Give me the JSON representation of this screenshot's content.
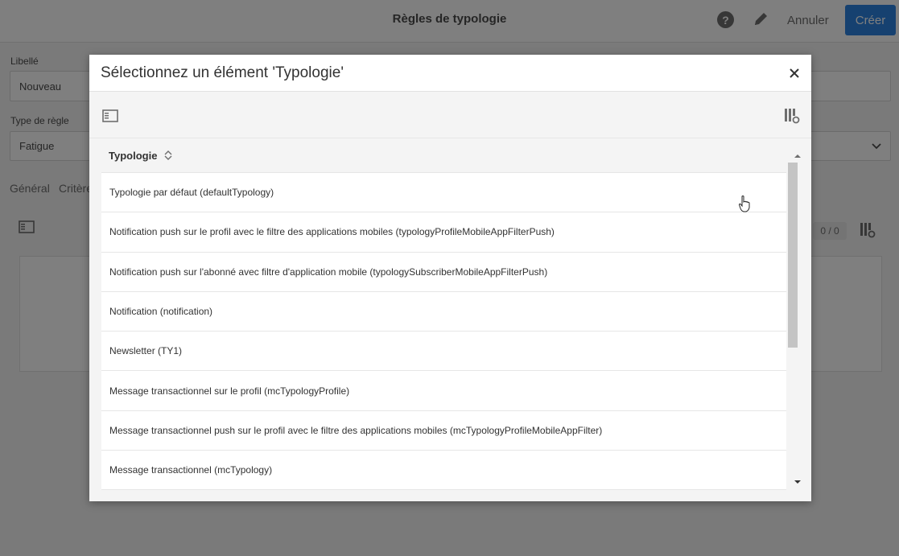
{
  "topbar": {
    "title": "Règles de typologie",
    "help_label": "?",
    "cancel_label": "Annuler",
    "create_label": "Créer"
  },
  "form": {
    "label_field": {
      "label": "Libellé",
      "value": "Nouveau"
    },
    "rule_type": {
      "label": "Type de règle",
      "value": "Fatigue"
    },
    "tabs": [
      {
        "label": "Général"
      },
      {
        "label": "Critère"
      }
    ],
    "counter": "0 / 0"
  },
  "modal": {
    "title": "Sélectionnez un élément 'Typologie'",
    "column_header": "Typologie",
    "rows": [
      {
        "label": "Typologie par défaut (defaultTypology)"
      },
      {
        "label": "Notification push sur le profil avec le filtre des applications mobiles (typologyProfileMobileAppFilterPush)"
      },
      {
        "label": "Notification push sur l'abonné avec filtre d'application mobile (typologySubscriberMobileAppFilterPush)"
      },
      {
        "label": "Notification (notification)"
      },
      {
        "label": "Newsletter (TY1)"
      },
      {
        "label": "Message transactionnel sur le profil (mcTypologyProfile)"
      },
      {
        "label": "Message transactionnel push sur le profil avec le filtre des applications mobiles (mcTypologyProfileMobileAppFilter)"
      },
      {
        "label": "Message transactionnel (mcTypology)"
      }
    ]
  },
  "icons": {
    "help": "help-circle-icon",
    "edit": "pencil-icon",
    "close": "close-icon",
    "panel": "panel-toggle-icon",
    "columns": "column-settings-icon",
    "sort": "sort-icon",
    "dropdown": "chevron-down-icon",
    "cursor": "hand-cursor-icon"
  },
  "colors": {
    "accent": "#2d82e0",
    "overlay": "#000000",
    "text": "#323232"
  }
}
